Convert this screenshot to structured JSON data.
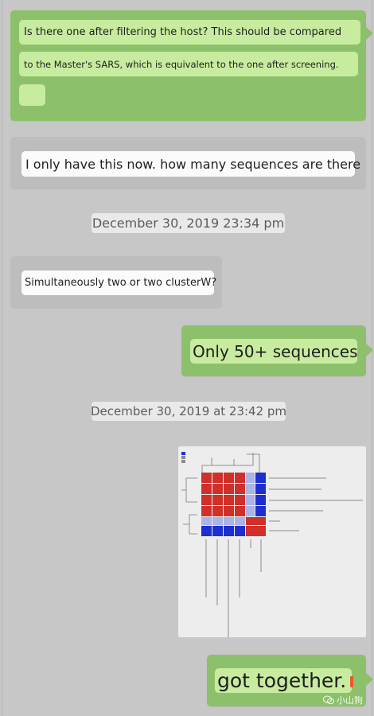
{
  "messages": {
    "m1": {
      "line1": "Is there one after filtering the host? This should be compared",
      "line2": "to the Master's SARS, which is equivalent to the one after screening."
    },
    "m2": {
      "text": "I only have this now. how many sequences are there"
    },
    "ts1": "December 30, 2019 23:34 pm",
    "m3": {
      "text": "Simultaneously two or two clusterW?"
    },
    "m4": {
      "text": "Only 50+ sequences"
    },
    "ts2": "December 30, 2019 at 23:42 pm",
    "m5": {
      "text": "got together."
    }
  },
  "watermark": {
    "text": "小山狗",
    "icon": "wechat-icon"
  },
  "heatmap": {
    "colors": {
      "red": "#d0302a",
      "lightblue": "#aab4e8",
      "blue": "#1d2fd0",
      "background": "#ededed"
    }
  }
}
